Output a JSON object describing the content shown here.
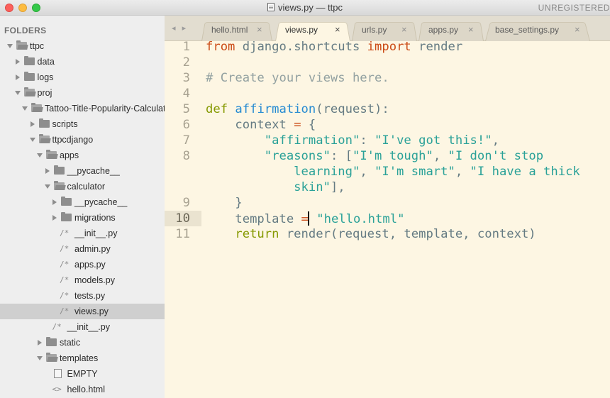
{
  "window": {
    "title": "views.py — ttpc",
    "registration_text": "UNREGISTERED"
  },
  "sidebar": {
    "heading": "FOLDERS",
    "tree": [
      {
        "label": "ttpc",
        "kind": "folder",
        "expanded": true,
        "depth": 0
      },
      {
        "label": "data",
        "kind": "folder",
        "expanded": false,
        "depth": 1
      },
      {
        "label": "logs",
        "kind": "folder",
        "expanded": false,
        "depth": 1
      },
      {
        "label": "proj",
        "kind": "folder",
        "expanded": true,
        "depth": 1
      },
      {
        "label": "Tattoo-Title-Popularity-Calculator",
        "kind": "folder",
        "expanded": true,
        "depth": 2
      },
      {
        "label": "scripts",
        "kind": "folder",
        "expanded": false,
        "depth": 3
      },
      {
        "label": "ttpcdjango",
        "kind": "folder",
        "expanded": true,
        "depth": 3
      },
      {
        "label": "apps",
        "kind": "folder",
        "expanded": true,
        "depth": 4
      },
      {
        "label": "__pycache__",
        "kind": "folder",
        "expanded": false,
        "depth": 5
      },
      {
        "label": "calculator",
        "kind": "folder",
        "expanded": true,
        "depth": 5
      },
      {
        "label": "__pycache__",
        "kind": "folder",
        "expanded": false,
        "depth": 6
      },
      {
        "label": "migrations",
        "kind": "folder",
        "expanded": false,
        "depth": 6
      },
      {
        "label": "__init__.py",
        "kind": "python-file",
        "depth": 6
      },
      {
        "label": "admin.py",
        "kind": "python-file",
        "depth": 6
      },
      {
        "label": "apps.py",
        "kind": "python-file",
        "depth": 6
      },
      {
        "label": "models.py",
        "kind": "python-file",
        "depth": 6
      },
      {
        "label": "tests.py",
        "kind": "python-file",
        "depth": 6
      },
      {
        "label": "views.py",
        "kind": "python-file",
        "depth": 6,
        "selected": true
      },
      {
        "label": "__init__.py",
        "kind": "python-file",
        "depth": 5
      },
      {
        "label": "static",
        "kind": "folder",
        "expanded": false,
        "depth": 4
      },
      {
        "label": "templates",
        "kind": "folder",
        "expanded": true,
        "depth": 4
      },
      {
        "label": "EMPTY",
        "kind": "empty-file",
        "depth": 5
      },
      {
        "label": "hello.html",
        "kind": "html-file",
        "depth": 5
      }
    ],
    "file_glyphs": {
      "python-file": "/*",
      "html-file": "<>"
    }
  },
  "tabs": [
    {
      "label": "hello.html",
      "close": "×",
      "active": false
    },
    {
      "label": "views.py",
      "close": "×",
      "active": true
    },
    {
      "label": "urls.py",
      "close": "×",
      "active": false
    },
    {
      "label": "apps.py",
      "close": "×",
      "active": false
    },
    {
      "label": "base_settings.py",
      "close": "×",
      "active": false
    }
  ],
  "nav_arrows": "◂ ▸",
  "editor": {
    "current_line": "10",
    "lines": [
      {
        "num": "1",
        "tokens": [
          [
            "kw",
            "from"
          ],
          [
            "plain",
            " django.shortcuts "
          ],
          [
            "kw",
            "import"
          ],
          [
            "plain",
            " render"
          ]
        ]
      },
      {
        "num": "2",
        "tokens": []
      },
      {
        "num": "3",
        "tokens": [
          [
            "com",
            "# Create your views here."
          ]
        ]
      },
      {
        "num": "4",
        "tokens": []
      },
      {
        "num": "5",
        "tokens": [
          [
            "kw-def",
            "def"
          ],
          [
            "plain",
            " "
          ],
          [
            "fn",
            "affirmation"
          ],
          [
            "plain",
            "(request):"
          ]
        ]
      },
      {
        "num": "6",
        "tokens": [
          [
            "plain",
            "    context "
          ],
          [
            "op",
            "="
          ],
          [
            "plain",
            " {"
          ]
        ]
      },
      {
        "num": "7",
        "tokens": [
          [
            "plain",
            "        "
          ],
          [
            "str",
            "\"affirmation\""
          ],
          [
            "plain",
            ": "
          ],
          [
            "str",
            "\"I've got this!\""
          ],
          [
            "plain",
            ","
          ]
        ]
      },
      {
        "num": "8",
        "tokens": [
          [
            "plain",
            "        "
          ],
          [
            "str",
            "\"reasons\""
          ],
          [
            "plain",
            ": ["
          ],
          [
            "str",
            "\"I'm tough\""
          ],
          [
            "plain",
            ", "
          ],
          [
            "str",
            "\"I don't stop"
          ]
        ]
      },
      {
        "num": "",
        "tokens": [
          [
            "str",
            "            learning\""
          ],
          [
            "plain",
            ", "
          ],
          [
            "str",
            "\"I'm smart\""
          ],
          [
            "plain",
            ", "
          ],
          [
            "str",
            "\"I have a thick"
          ]
        ]
      },
      {
        "num": "",
        "tokens": [
          [
            "str",
            "            skin\""
          ],
          [
            "plain",
            "],"
          ]
        ]
      },
      {
        "num": "9",
        "tokens": [
          [
            "plain",
            "    }"
          ]
        ]
      },
      {
        "num": "10",
        "tokens": [
          [
            "plain",
            "    template "
          ],
          [
            "op",
            "="
          ],
          [
            "cursor",
            ""
          ],
          [
            "plain",
            " "
          ],
          [
            "str",
            "\"hello.html\""
          ]
        ]
      },
      {
        "num": "11",
        "tokens": [
          [
            "kw-def",
            "    return"
          ],
          [
            "plain",
            " render(request, template, context)"
          ]
        ]
      }
    ]
  }
}
